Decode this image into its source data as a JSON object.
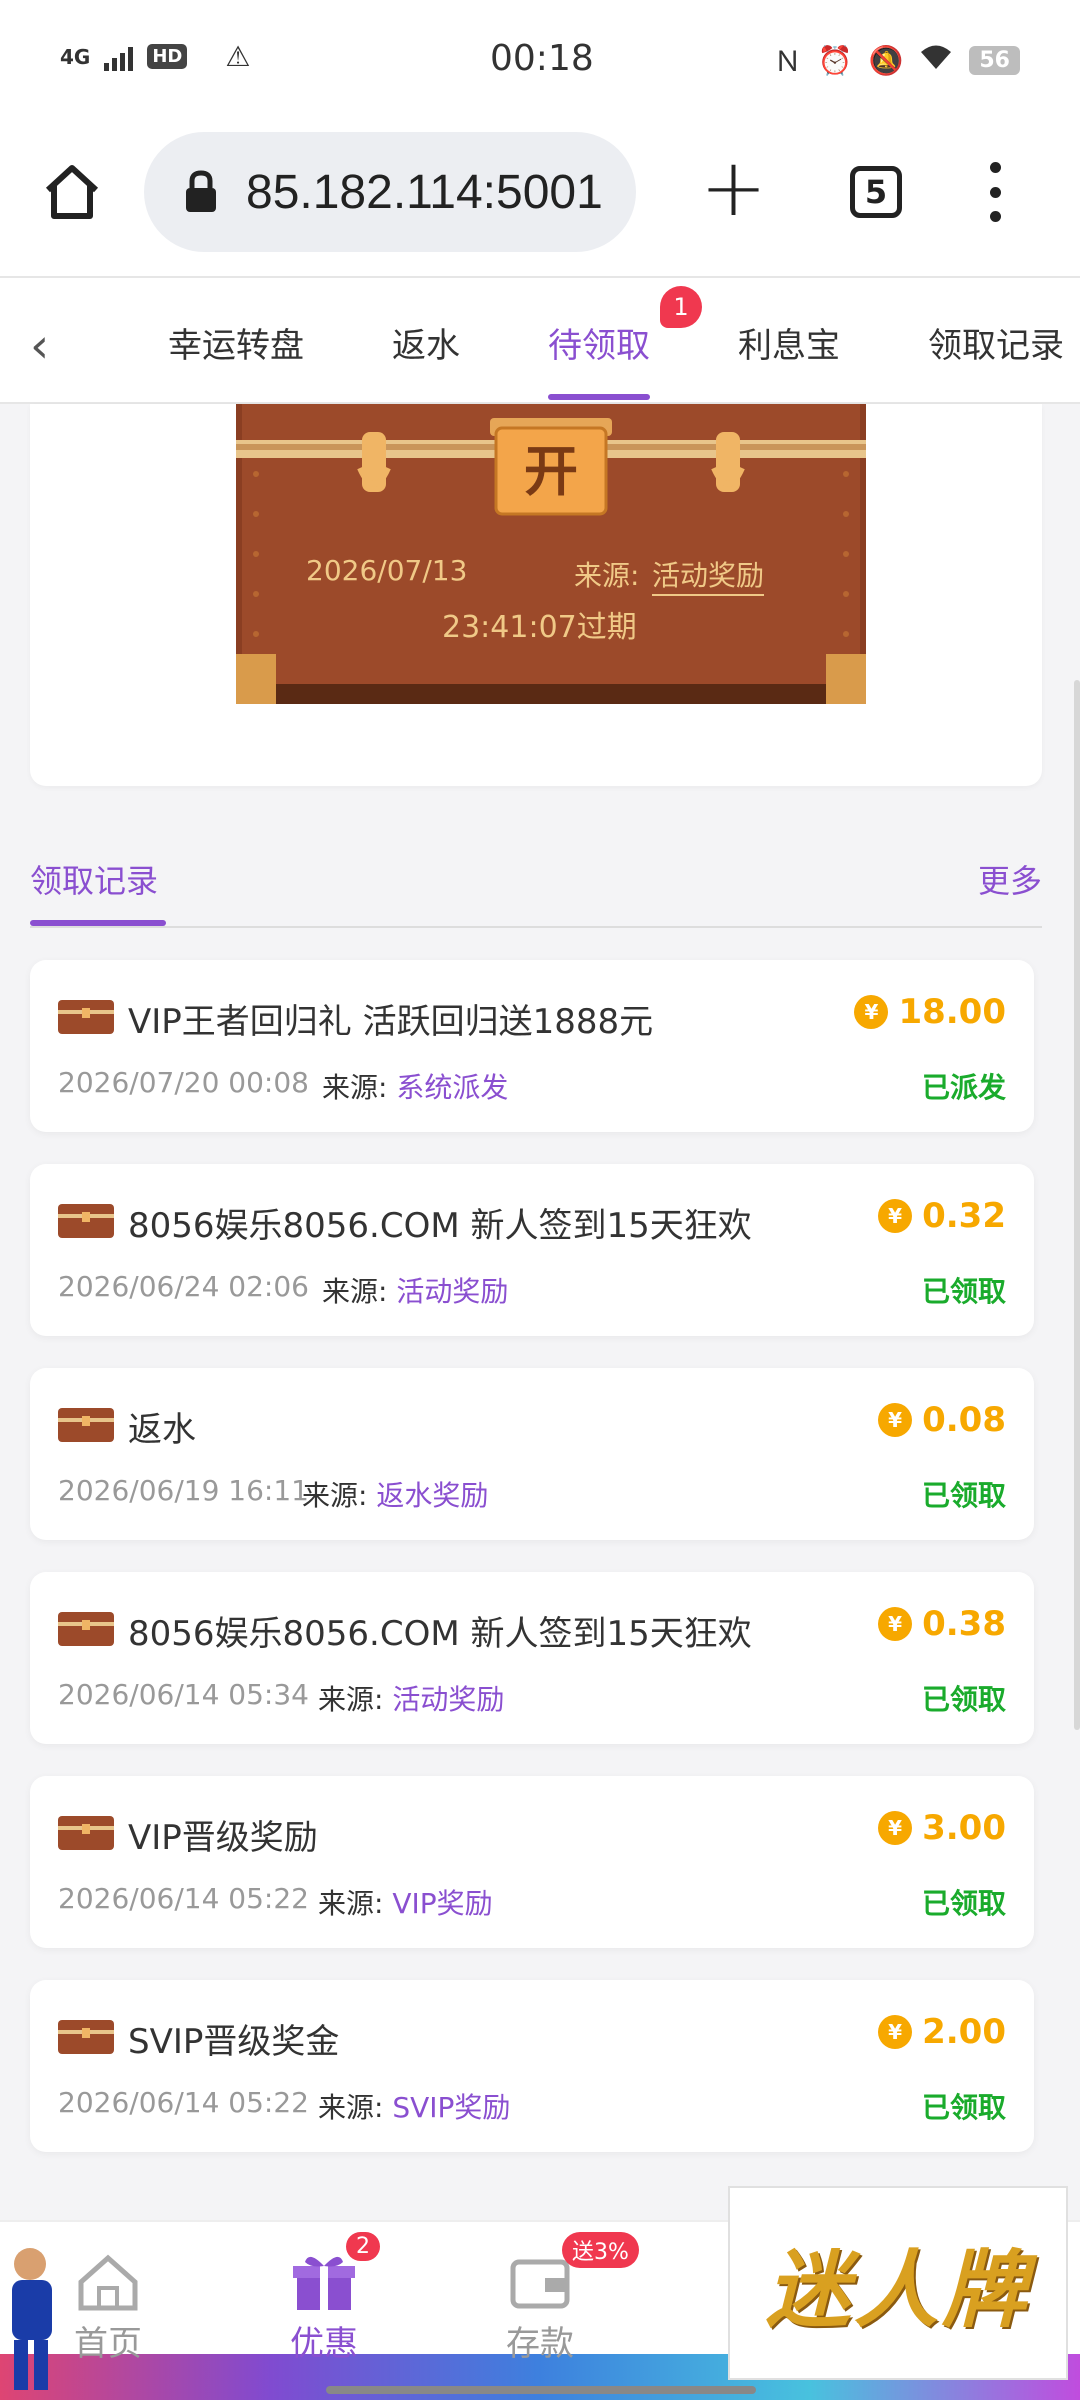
{
  "status_bar": {
    "network": "4G",
    "hd": "HD",
    "time": "00:18",
    "battery": "56"
  },
  "browser": {
    "url": "85.182.114:5001",
    "tab_count": "5"
  },
  "tabs": {
    "items": [
      {
        "label": "幸运转盘"
      },
      {
        "label": "返水"
      },
      {
        "label": "待领取"
      },
      {
        "label": "利息宝"
      },
      {
        "label": "领取记录"
      }
    ],
    "active_index": 2,
    "badge": "1"
  },
  "chest": {
    "open_label": "开",
    "date": "2026/07/13",
    "source_label": "来源:",
    "source_value": "活动奖励",
    "expire": "23:41:07过期"
  },
  "records_section": {
    "title": "领取记录",
    "more": "更多"
  },
  "records": [
    {
      "title": "VIP王者回归礼 活跃回归送1888元",
      "amount": "18.00",
      "time": "2026/07/20 00:08",
      "source_label": "来源:",
      "source": "系统派发",
      "status": "已派发"
    },
    {
      "title": "8056娱乐8056.COM 新人签到15天狂欢",
      "amount": "0.32",
      "time": "2026/06/24 02:06",
      "source_label": "来源:",
      "source": "活动奖励",
      "status": "已领取"
    },
    {
      "title": "返水",
      "amount": "0.08",
      "time": "2026/06/19 16:11",
      "source_label": "来源:",
      "source": "返水奖励",
      "status": "已领取"
    },
    {
      "title": "8056娱乐8056.COM 新人签到15天狂欢",
      "amount": "0.38",
      "time": "2026/06/14 05:34",
      "source_label": "来源:",
      "source": "活动奖励",
      "status": "已领取"
    },
    {
      "title": "VIP晋级奖励",
      "amount": "3.00",
      "time": "2026/06/14 05:22",
      "source_label": "来源:",
      "source": "VIP奖励",
      "status": "已领取"
    },
    {
      "title": "SVIP晋级奖金",
      "amount": "2.00",
      "time": "2026/06/14 05:22",
      "source_label": "来源:",
      "source": "SVIP奖励",
      "status": "已领取"
    }
  ],
  "bottom_nav": {
    "home": "首页",
    "promo": "优惠",
    "promo_badge": "2",
    "deposit": "存款",
    "deposit_badge": "送3%"
  },
  "logo": "迷人牌",
  "colors": {
    "accent": "#8a4fd0",
    "amount": "#f7a800",
    "status_green": "#1aab2c",
    "badge_red": "#f0384f"
  }
}
